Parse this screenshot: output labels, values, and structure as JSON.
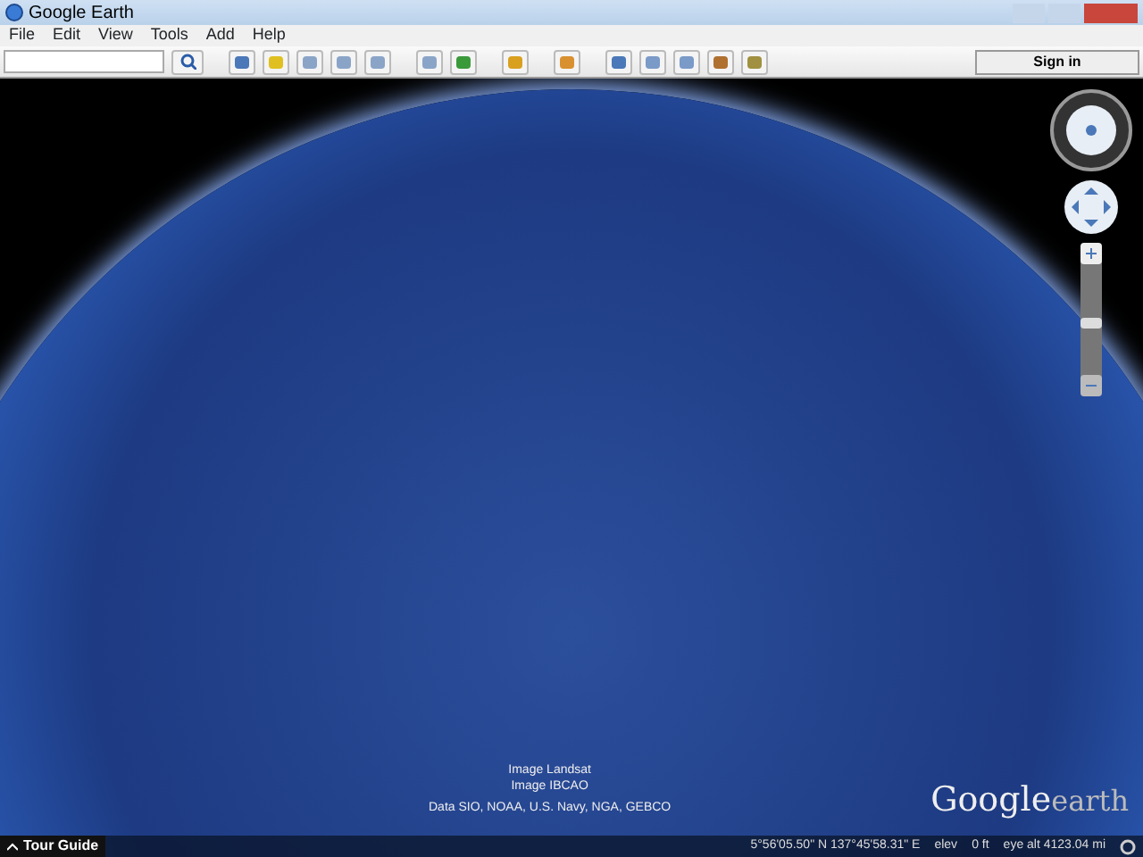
{
  "window": {
    "title": "Google Earth"
  },
  "menu": [
    "File",
    "Edit",
    "View",
    "Tools",
    "Add",
    "Help"
  ],
  "toolbar": {
    "sign_in": "Sign in"
  },
  "navigation": {
    "zoom": {
      "level": 0.52
    }
  },
  "attributions": [
    "Image Landsat",
    "Image IBCAO",
    "Data SIO, NOAA, U.S. Navy, NGA, GEBCO"
  ],
  "logo": {
    "word_1": "Google",
    "word_2": "earth"
  },
  "status_bar": {
    "tour_guide": "Tour Guide",
    "coordinates": "5°56'05.50\" N  137°45'58.31\" E",
    "elev_label": "elev",
    "elev_value": "0 ft",
    "eye_alt": "eye alt 4123.04 mi"
  }
}
